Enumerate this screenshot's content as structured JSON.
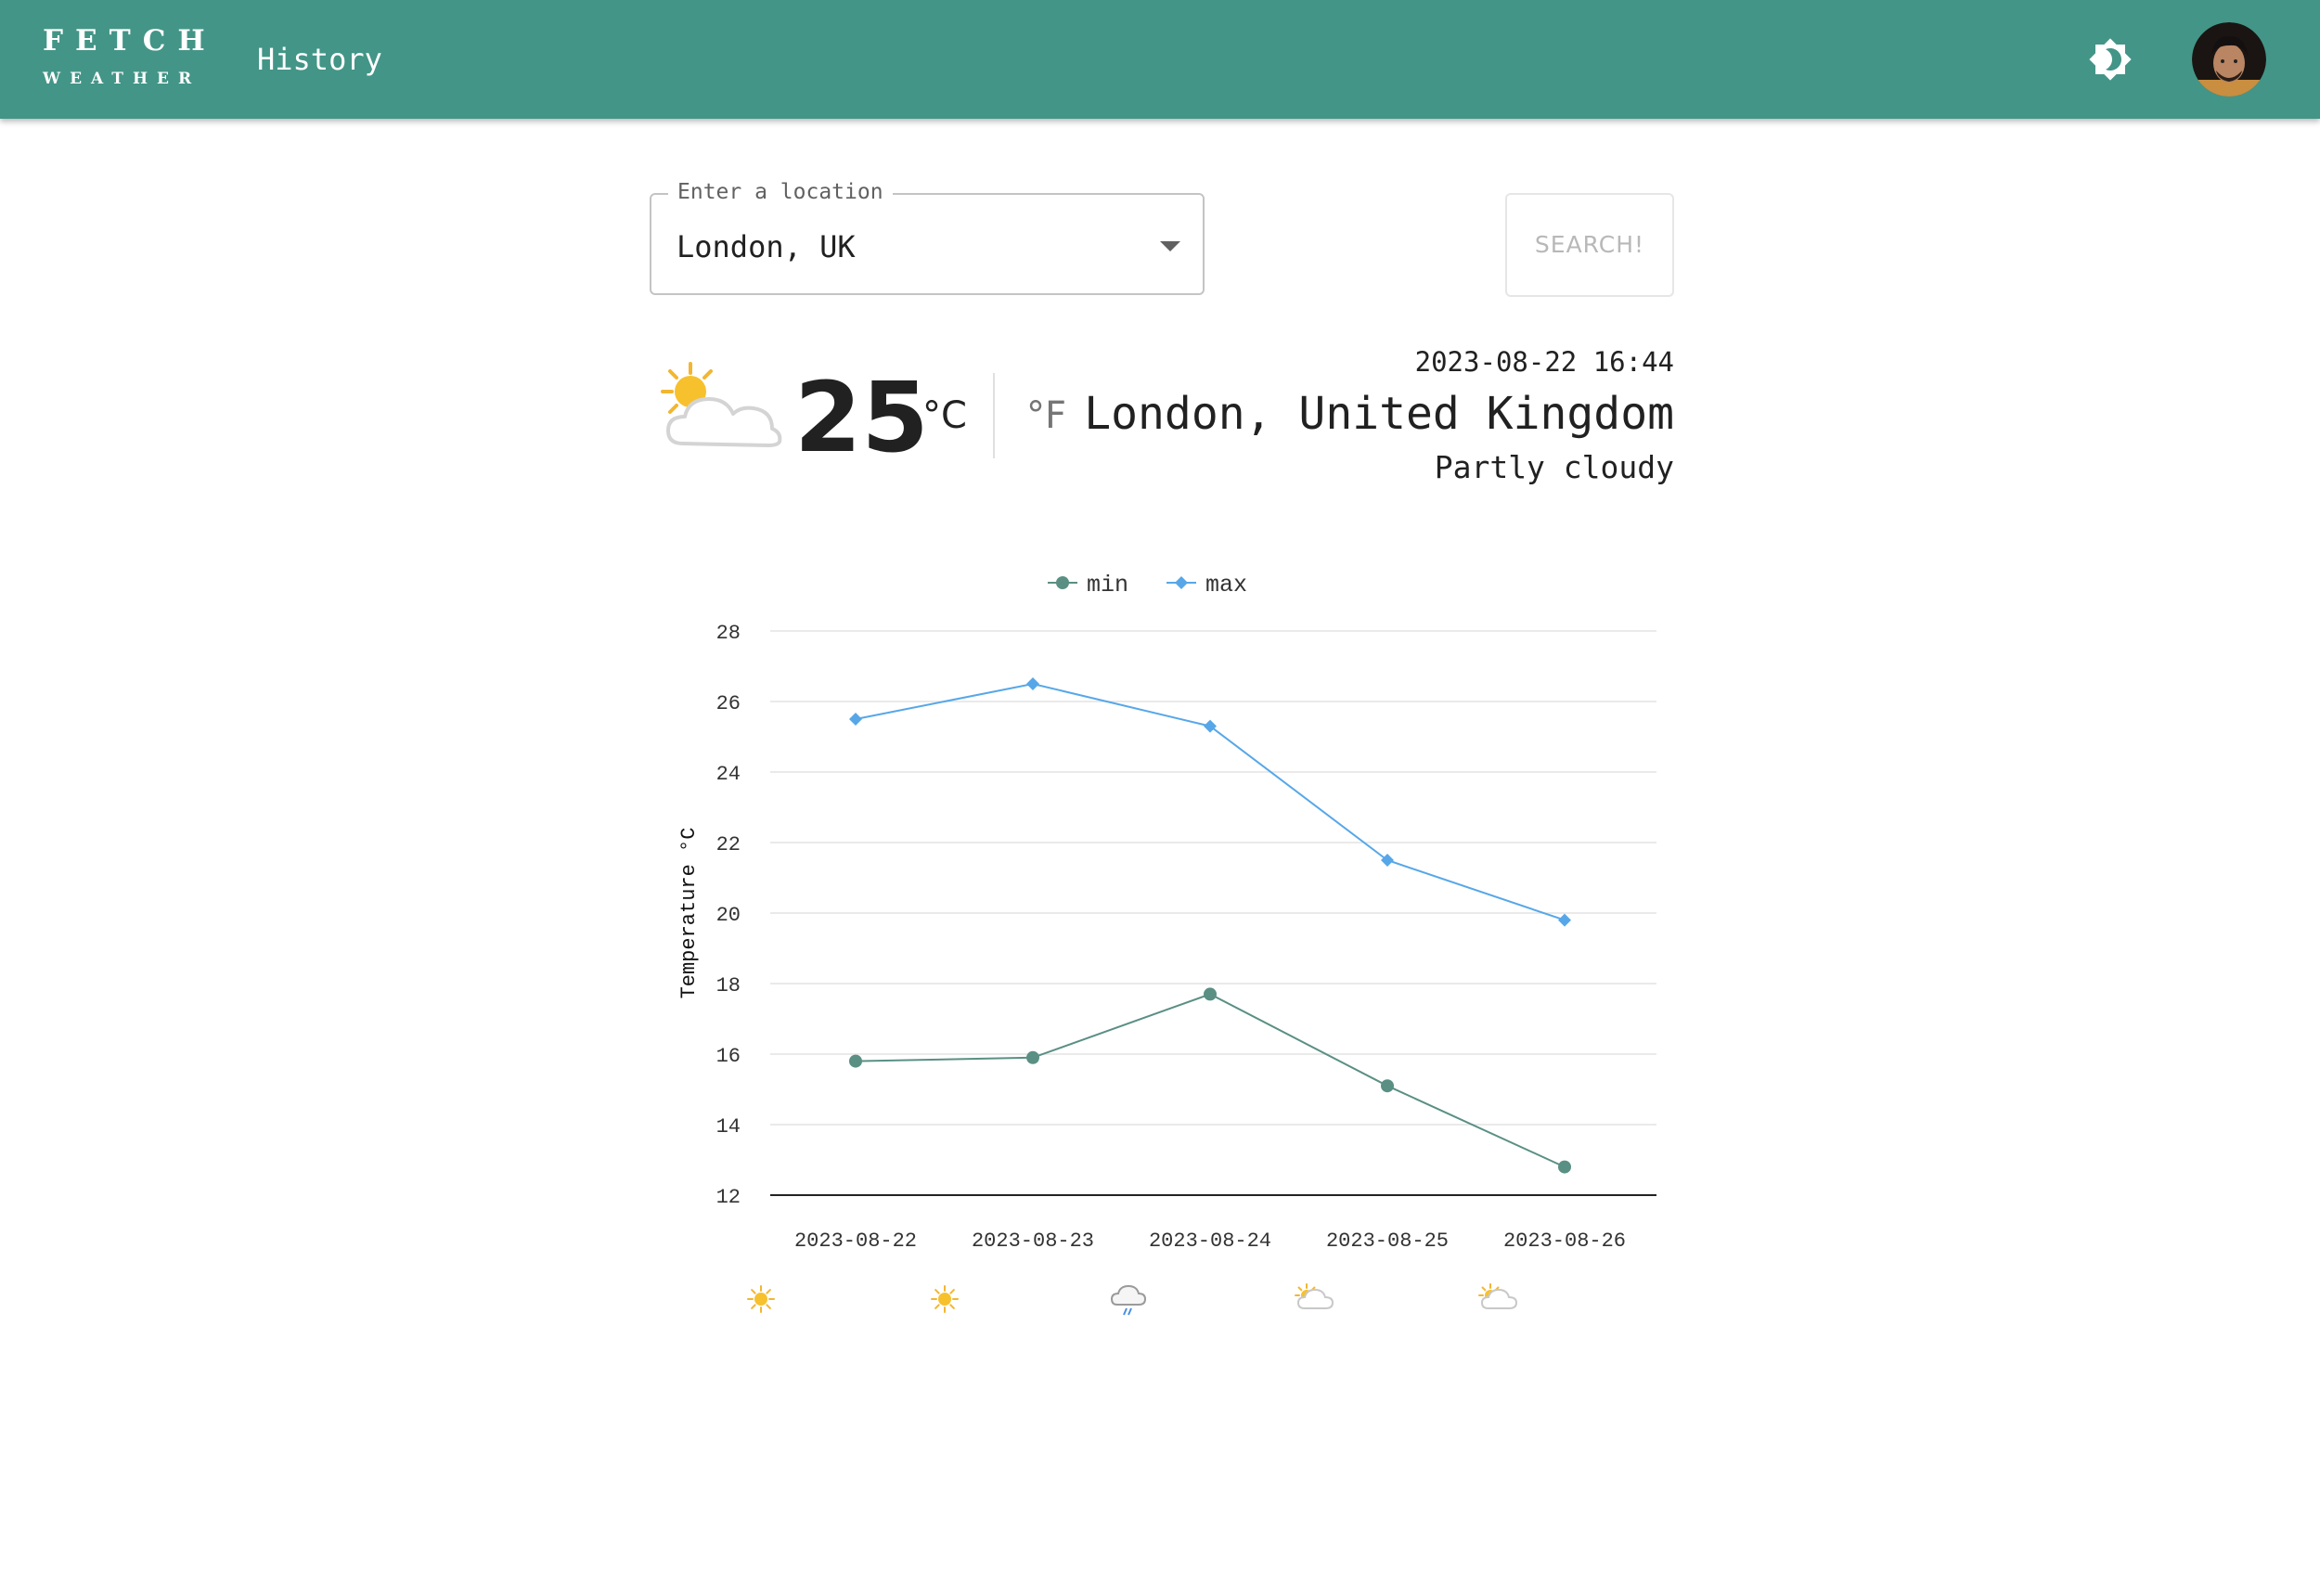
{
  "header": {
    "logo_top": "FETCH",
    "logo_bottom": "WEATHER",
    "nav_history": "History",
    "theme_icon": "brightness-icon",
    "avatar_icon": "user-avatar"
  },
  "search": {
    "label": "Enter a location",
    "value": "London, UK",
    "button_label": "SEARCH!"
  },
  "current": {
    "icon": "partly-cloudy-icon",
    "temperature": "25",
    "unit_c": "°C",
    "unit_f": "°F",
    "datetime": "2023-08-22 16:44",
    "location": "London, United Kingdom",
    "condition": "Partly cloudy"
  },
  "colors": {
    "appbar": "#439587",
    "min_series": "#5a8f84",
    "max_series": "#57a7e8"
  },
  "chart_data": {
    "type": "line",
    "categories": [
      "2023-08-22",
      "2023-08-23",
      "2023-08-24",
      "2023-08-25",
      "2023-08-26"
    ],
    "series": [
      {
        "name": "min",
        "values": [
          15.8,
          15.9,
          17.7,
          15.1,
          12.8
        ],
        "color": "#5a8f84",
        "marker": "circle"
      },
      {
        "name": "max",
        "values": [
          25.5,
          26.5,
          25.3,
          21.5,
          19.8
        ],
        "color": "#57a7e8",
        "marker": "diamond"
      }
    ],
    "ylabel": "Temperature °C",
    "xlabel": "",
    "ylim": [
      12,
      28
    ],
    "yticks": [
      12,
      14,
      16,
      18,
      20,
      22,
      24,
      26,
      28
    ],
    "grid": true,
    "legend": "top-center",
    "condition_icons": [
      "sunny-icon",
      "sunny-icon",
      "rain-icon",
      "partly-cloudy-icon",
      "partly-cloudy-icon"
    ]
  }
}
